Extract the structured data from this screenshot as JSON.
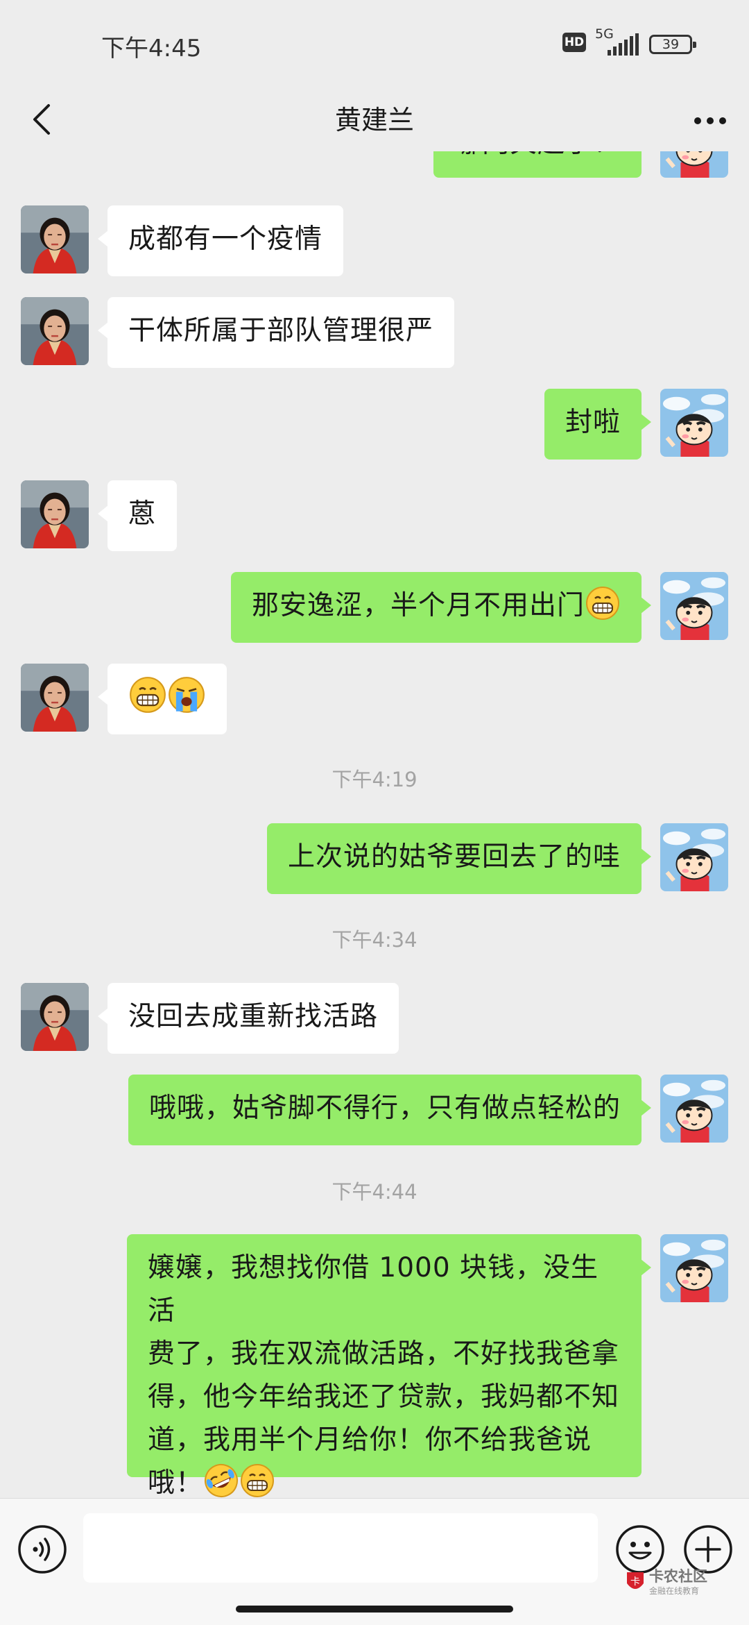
{
  "status_bar": {
    "time": "下午4:45",
    "hd": "HD",
    "network": "5G",
    "battery": "39"
  },
  "header": {
    "title": "黄建兰",
    "back_icon": "chevron-left-icon",
    "more_icon": "more-dots-icon"
  },
  "messages": [
    {
      "side": "out",
      "text": "哪门关起了！"
    },
    {
      "side": "in",
      "text": "成都有一个疫情"
    },
    {
      "side": "in",
      "text": "干体所属于部队管理很严"
    },
    {
      "side": "out",
      "text": "封啦"
    },
    {
      "side": "in",
      "text": "蒽"
    },
    {
      "side": "out",
      "text": "那安逸涩，半个月不用出门",
      "emoji_after": [
        "grin-emoji"
      ]
    },
    {
      "side": "in",
      "text": "",
      "emoji_after": [
        "grin-emoji",
        "crying-emoji"
      ]
    },
    {
      "timestamp": "下午4:19"
    },
    {
      "side": "out",
      "text": "上次说的姑爷要回去了的哇"
    },
    {
      "timestamp": "下午4:34"
    },
    {
      "side": "in",
      "text": "没回去成重新找活路"
    },
    {
      "side": "out",
      "text": "哦哦，姑爷脚不得行，只有做点轻松的"
    },
    {
      "timestamp": "下午4:44"
    },
    {
      "side": "out",
      "lines": [
        "嬢嬢，我想找你借 1000 块钱，没生活",
        "费了，我在双流做活路，不好找我爸拿",
        "得，他今年给我还了贷款，我妈都不知",
        "道，我用半个月给你！你不给我爸说",
        "哦！"
      ],
      "emoji_after": [
        "rolling-laugh-emoji",
        "grin-emoji"
      ]
    }
  ],
  "input_bar": {
    "voice_icon": "voice-icon",
    "input_value": "",
    "emoji_icon": "emoji-icon",
    "plus_icon": "plus-icon"
  },
  "watermark": {
    "brand": "卡农社区",
    "tagline": "金融在线教育"
  },
  "colors": {
    "background": "#ededed",
    "outgoing_bubble": "#95ec69",
    "incoming_bubble": "#ffffff",
    "timestamp": "#a3a3a3"
  }
}
